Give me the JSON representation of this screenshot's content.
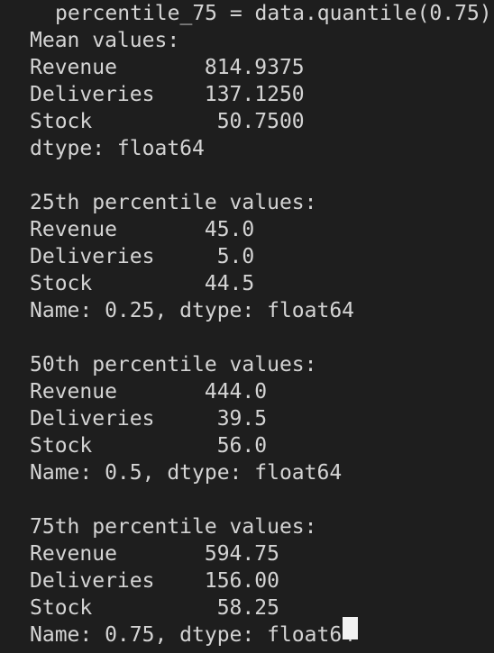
{
  "code_line": "percentile_75 = data.quantile(0.75)",
  "output_lines": [
    "Mean values:",
    "Revenue       814.9375",
    "Deliveries    137.1250",
    "Stock          50.7500",
    "dtype: float64",
    "",
    "25th percentile values:",
    "Revenue       45.0",
    "Deliveries     5.0",
    "Stock         44.5",
    "Name: 0.25, dtype: float64",
    "",
    "50th percentile values:",
    "Revenue       444.0",
    "Deliveries     39.5",
    "Stock          56.0",
    "Name: 0.5, dtype: float64",
    "",
    "75th percentile values:",
    "Revenue       594.75",
    "Deliveries    156.00",
    "Stock          58.25",
    "Name: 0.75, dtype: float64"
  ]
}
